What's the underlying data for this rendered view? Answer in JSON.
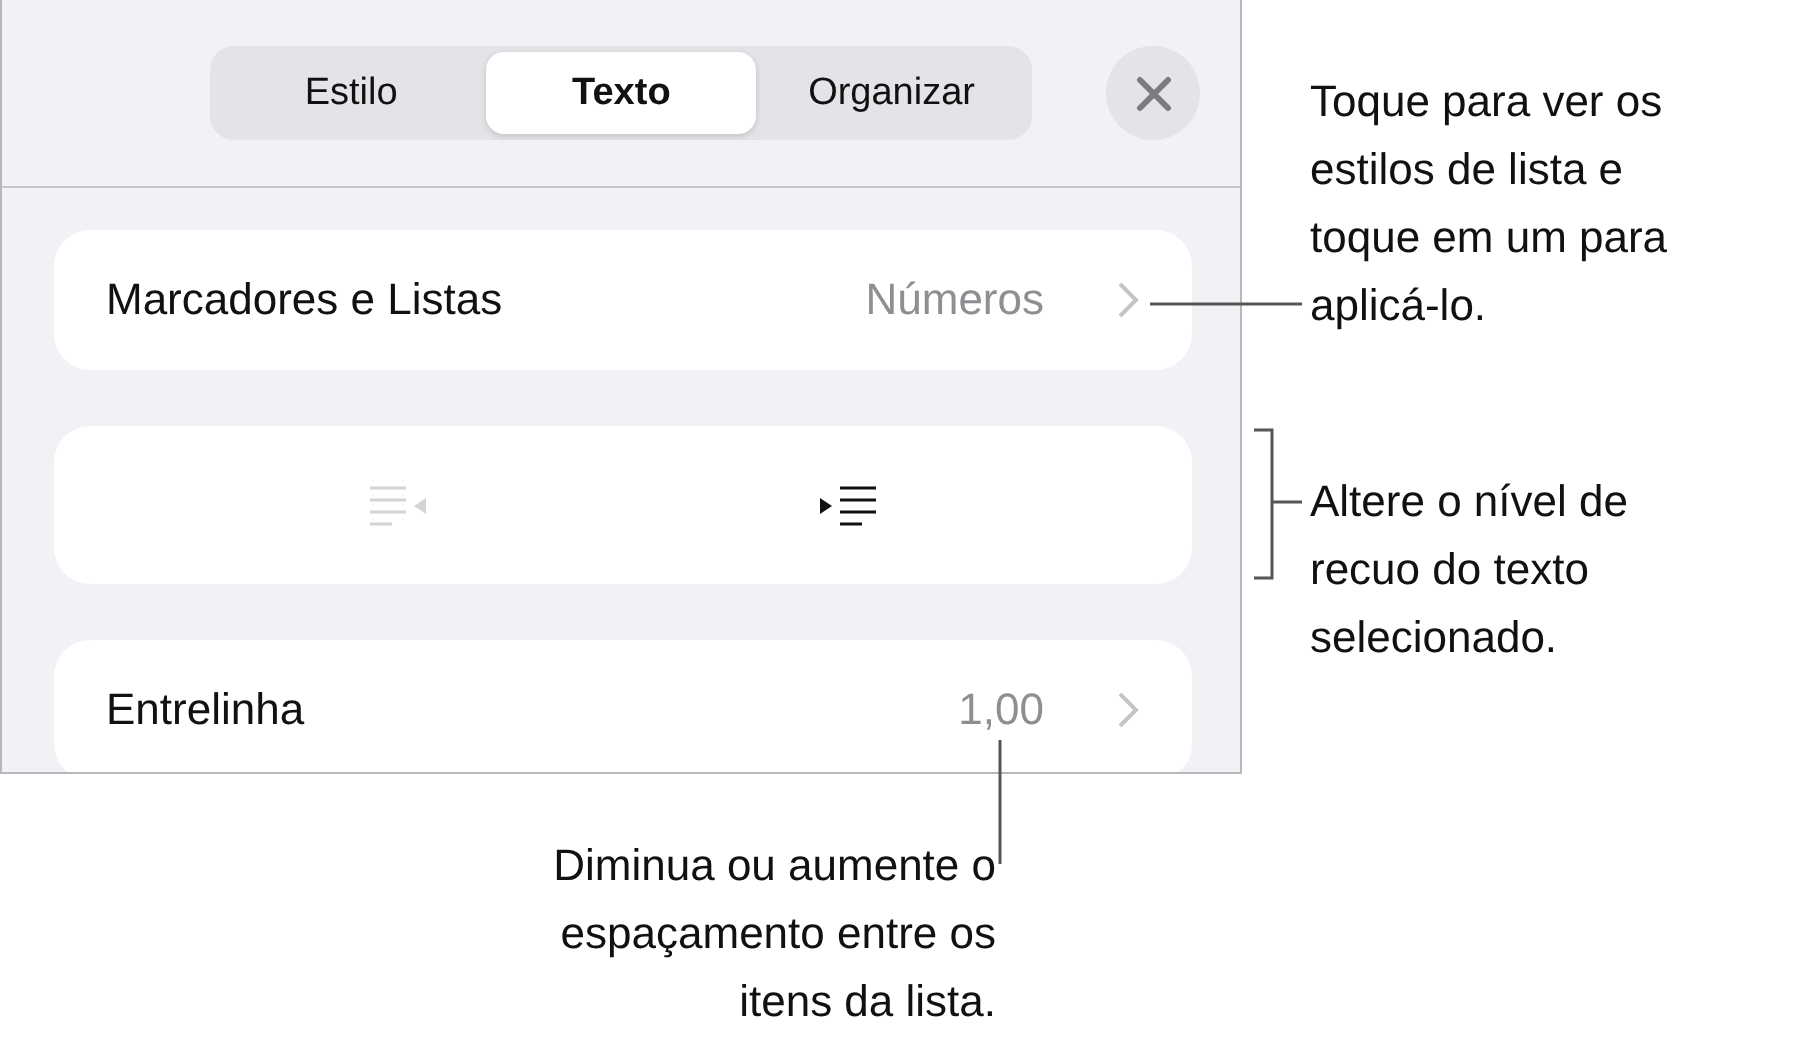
{
  "tabs": [
    {
      "label": "Estilo",
      "selected": false
    },
    {
      "label": "Texto",
      "selected": true
    },
    {
      "label": "Organizar",
      "selected": false
    }
  ],
  "rows": [
    {
      "kind": "nav",
      "label": "Marcadores e Listas",
      "value": "Números"
    },
    {
      "kind": "indent",
      "buttons": [
        {
          "kind": "decrease",
          "disabled": true
        },
        {
          "kind": "increase",
          "disabled": false
        }
      ]
    },
    {
      "kind": "nav",
      "label": "Entrelinha",
      "value": "1,00"
    }
  ],
  "callouts": [
    {
      "kind": "right",
      "text": "Toque para ver os\nestilos de lista e\ntoque em um para\naplicá-lo."
    },
    {
      "kind": "bracket",
      "text": "Altere o nível de\nrecuo do texto\nselecionado."
    },
    {
      "kind": "below",
      "text": "Diminua ou aumente o\nespaçamento entre os\nitens da lista."
    }
  ]
}
